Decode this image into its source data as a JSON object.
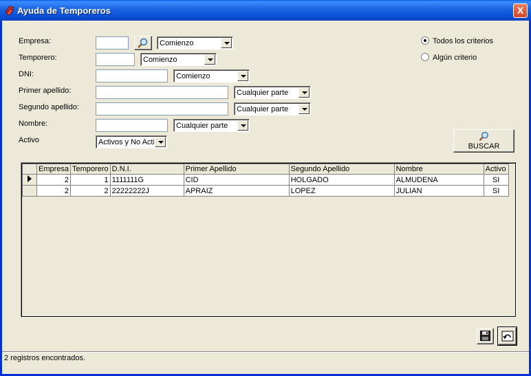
{
  "window": {
    "title": "Ayuda de Temporeros",
    "close_label": "X"
  },
  "filters": {
    "empresa": {
      "label": "Empresa:",
      "value": "",
      "mode": "Comienzo"
    },
    "temporero": {
      "label": "Temporero:",
      "value": "",
      "mode": "Comienzo"
    },
    "dni": {
      "label": "DNI:",
      "value": "",
      "mode": "Comienzo"
    },
    "primer_apellido": {
      "label": "Primer apellido:",
      "value": "",
      "mode": "Cualquier parte"
    },
    "segundo_apellido": {
      "label": "Segundo apellido:",
      "value": "",
      "mode": "Cualquier parte"
    },
    "nombre": {
      "label": "Nombre:",
      "value": "",
      "mode": "Cualquier parte"
    },
    "activo": {
      "label": "Activo",
      "value": "Activos y No Activos"
    }
  },
  "criteria": {
    "all_label": "Todos los criterios",
    "any_label": "Algún criterio",
    "selected": "all"
  },
  "search_button": {
    "label": "BUSCAR",
    "icon": "search-icon"
  },
  "grid": {
    "columns": [
      "Empresa",
      "Temporero",
      "D.N.I.",
      "Primer Apellido",
      "Segundo Apellido",
      "Nombre",
      "Activo"
    ],
    "rows": [
      {
        "empresa": "2",
        "temporero": "1",
        "dni": "1111111G",
        "apellido1": "CID",
        "apellido2": "HOLGADO",
        "nombre": "ALMUDENA",
        "activo": "SI",
        "current": true
      },
      {
        "empresa": "2",
        "temporero": "2",
        "dni": "22222222J",
        "apellido1": "APRAIZ",
        "apellido2": "LOPEZ",
        "nombre": "JULIAN",
        "activo": "SI",
        "current": false
      }
    ]
  },
  "footer_buttons": {
    "save_icon": "floppy-disk-icon",
    "undo_icon": "undo-icon"
  },
  "status": {
    "text": "2 registros encontrados."
  },
  "colors": {
    "titlebar": "#0a4fd4",
    "window_bg": "#ece9d8",
    "close": "#d2452b"
  }
}
